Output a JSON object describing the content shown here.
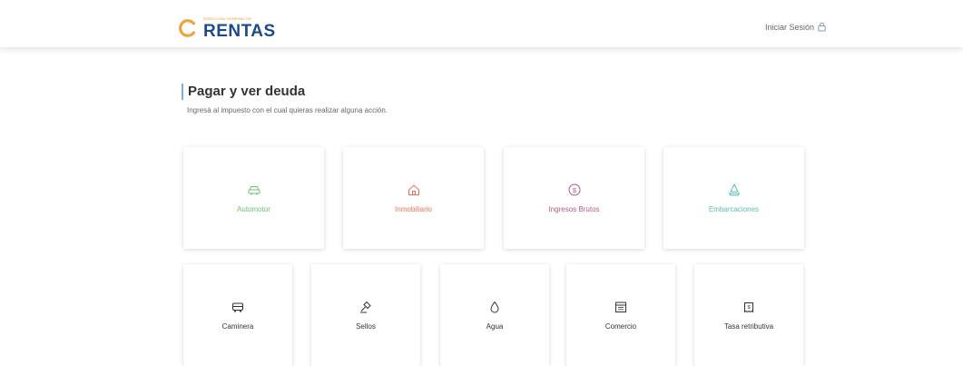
{
  "header": {
    "logo_small": "DIRECCIÓN GENERAL DE",
    "logo_big": "RENTAS",
    "login_label": "Iniciar Sesión"
  },
  "page": {
    "title": "Pagar y ver deuda",
    "subtitle": "Ingresá al impuesto con el cual quieras realizar alguna acción."
  },
  "cards_row1": [
    {
      "label": "Automotor",
      "icon": "car-icon",
      "color": "#6fbf73"
    },
    {
      "label": "Inmobiliario",
      "icon": "house-icon",
      "color": "#e8775a"
    },
    {
      "label": "Ingresos Brutos",
      "icon": "dollar-coin-icon",
      "color": "#b55a88"
    },
    {
      "label": "Embarcaciones",
      "icon": "sailboat-icon",
      "color": "#5cbcb0"
    }
  ],
  "cards_row2": [
    {
      "label": "Caminera",
      "icon": "truck-icon",
      "color": "#333333"
    },
    {
      "label": "Sellos",
      "icon": "stamp-icon",
      "color": "#333333"
    },
    {
      "label": "Agua",
      "icon": "water-drop-icon",
      "color": "#333333"
    },
    {
      "label": "Comercio",
      "icon": "calendar-icon",
      "color": "#333333"
    },
    {
      "label": "Tasa retributiva",
      "icon": "receipt-icon",
      "color": "#333333"
    }
  ]
}
